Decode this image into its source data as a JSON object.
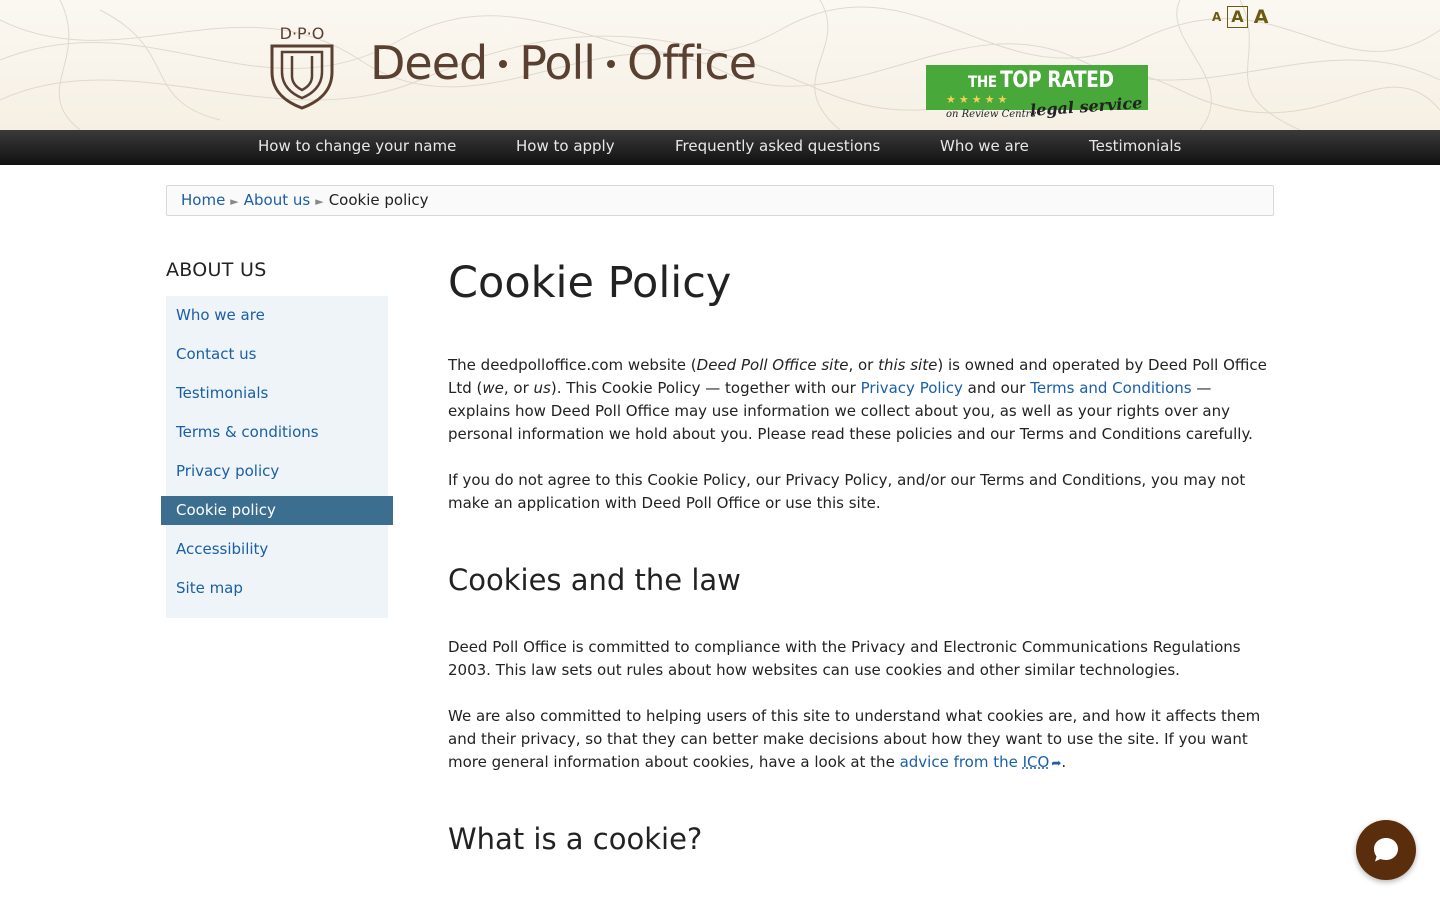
{
  "header": {
    "logo_monogram": "D·P·O",
    "brand_parts": [
      "Deed",
      "Poll",
      "Office"
    ],
    "font_size_controls": [
      "A",
      "A",
      "A"
    ],
    "badge": {
      "the": "THE",
      "top_rated": "TOP RATED",
      "stars": "★★★★★",
      "legal": "legal service",
      "review": "on Review Centre",
      "bg_color": "#49a83a"
    }
  },
  "nav": {
    "items": [
      "How to change your name",
      "How to apply",
      "Frequently asked questions",
      "Who we are",
      "Testimonials"
    ]
  },
  "breadcrumb": {
    "home": "Home",
    "sep": "►",
    "about": "About us",
    "current": "Cookie policy"
  },
  "sidebar": {
    "title": "ABOUT US",
    "items": [
      "Who we are",
      "Contact us",
      "Testimonials",
      "Terms & conditions",
      "Privacy policy",
      "Cookie policy",
      "Accessibility",
      "Site map"
    ],
    "active_index": 5,
    "active_color": "#3c6e8f"
  },
  "main": {
    "title": "Cookie Policy",
    "p1": {
      "t1": "The deedpolloffice.com website (",
      "em1": "Deed Poll Office site",
      "t2": ", or ",
      "em2": "this site",
      "t3": ") is owned and operated by Deed Poll Office Ltd (",
      "em3": "we",
      "t4": ", or ",
      "em4": "us",
      "t5": ").  This Cookie Policy — together with our ",
      "link1": "Privacy Policy",
      "t6": " and our ",
      "link2": "Terms and Conditions",
      "t7": " — explains how Deed Poll Office may use information we collect about you, as well as your rights over any personal information we hold about you.  Please read these policies and our Terms and Conditions carefully."
    },
    "p2": "If you do not agree to this Cookie Policy, our Privacy Policy, and/or our Terms and Conditions, you may not make an application with Deed Poll Office or use this site.",
    "h2_law": "Cookies and the law",
    "p3": "Deed Poll Office is committed to compliance with the Privacy and Electronic Communications Regulations 2003.  This law sets out rules about how websites can use cookies and other similar technologies.",
    "p4": {
      "t1": "We are also committed to helping users of this site to understand what cookies are, and how it affects them and their privacy, so that they can better make decisions about how they want to use the site.  If you want more general information about cookies, have a look at the ",
      "link": "advice from the ",
      "abbr": "ICO",
      "t2": "."
    },
    "h2_what": "What is a cookie?"
  },
  "colors": {
    "link": "#1a5fa8",
    "brand_brown": "#5a4030",
    "chat_bg": "#5a2d0c"
  }
}
